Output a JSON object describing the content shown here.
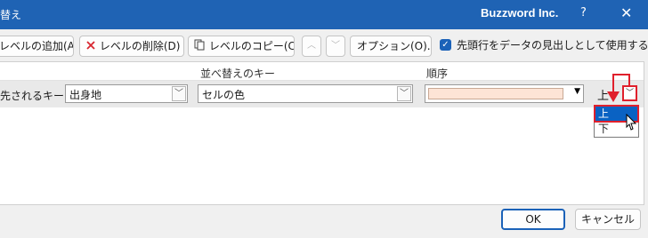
{
  "window": {
    "title": "替え",
    "brand": "Buzzword Inc.",
    "help": "?",
    "close": "✕"
  },
  "toolbar": {
    "add_level": "レベルの追加(A)",
    "delete_level": "レベルの削除(D)",
    "copy_level": "レベルのコピー(C)",
    "move_up": "︿",
    "move_down": "﹀",
    "options": "オプション(O)...",
    "header_checkbox_label": "先頭行をデータの見出しとして使用する(H)",
    "header_checkbox_checked": true
  },
  "grid": {
    "headers": {
      "sort_key": "並べ替えのキー",
      "order": "順序"
    },
    "row": {
      "label": "先されるキー",
      "column": "出身地",
      "sort_on": "セルの色",
      "color_value": "#fde4d6",
      "order": "上"
    }
  },
  "dropdown": {
    "options": [
      "上",
      "下"
    ],
    "selected": "上"
  },
  "footer": {
    "ok": "OK",
    "cancel": "キャンセル"
  },
  "colors": {
    "titlebar": "#1f63b4",
    "highlight": "#e0202c",
    "selection": "#0a62c3"
  }
}
